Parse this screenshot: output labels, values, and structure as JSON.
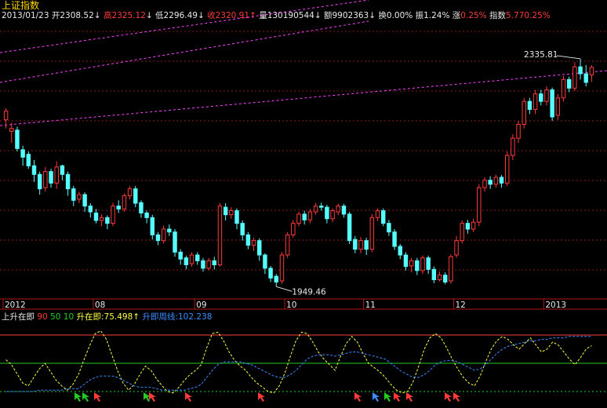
{
  "title": "上证指数",
  "quote": {
    "date": "2013/01/23",
    "open_label": "开",
    "open": "2308.52",
    "high_label": "高",
    "high": "2325.12",
    "low_label": "低",
    "low": "2296.49",
    "close_label": "收",
    "close": "2320.91",
    "vol_label": "量",
    "vol": "130190544",
    "amt_label": "额",
    "amt": "9902363",
    "turn_label": "换",
    "turn": "0.00%",
    "amp_label": "振",
    "amp": "1.24%",
    "chg_label": "涨",
    "chg": "0.25%",
    "idx_label": "指数",
    "idx": "5.77",
    "idx_chg": "0.25%"
  },
  "colors": {
    "up": "#ff3a3a",
    "down": "#55ffff",
    "bg": "#000000",
    "grid": "#8a1c1c",
    "axis": "#b01818",
    "title": "#ffd800",
    "trend": "#ff44ff"
  },
  "chart_data": [
    {
      "type": "candlestick",
      "title": "上证指数",
      "x_ticks": [
        "2012",
        "08",
        "09",
        "10",
        "11",
        "12",
        "2013"
      ],
      "annotations": [
        {
          "text": "2335.81",
          "kind": "high"
        },
        {
          "text": "1949.46",
          "kind": "low"
        }
      ],
      "ylim": [
        1920,
        2400
      ],
      "grid": true,
      "candles": [
        [
          2230,
          2245,
          2215,
          2250
        ],
        [
          2210,
          2215,
          2190,
          2225
        ],
        [
          2212,
          2180,
          2175,
          2218
        ],
        [
          2178,
          2165,
          2150,
          2185
        ],
        [
          2170,
          2150,
          2145,
          2175
        ],
        [
          2150,
          2135,
          2122,
          2160
        ],
        [
          2135,
          2110,
          2100,
          2140
        ],
        [
          2112,
          2140,
          2105,
          2148
        ],
        [
          2140,
          2120,
          2112,
          2145
        ],
        [
          2120,
          2148,
          2110,
          2158
        ],
        [
          2150,
          2135,
          2125,
          2152
        ],
        [
          2135,
          2110,
          2098,
          2140
        ],
        [
          2110,
          2090,
          2080,
          2115
        ],
        [
          2092,
          2100,
          2085,
          2105
        ],
        [
          2100,
          2080,
          2070,
          2104
        ],
        [
          2080,
          2070,
          2060,
          2085
        ],
        [
          2068,
          2055,
          2050,
          2075
        ],
        [
          2055,
          2060,
          2045,
          2066
        ],
        [
          2060,
          2050,
          2040,
          2064
        ],
        [
          2050,
          2080,
          2045,
          2086
        ],
        [
          2080,
          2075,
          2068,
          2090
        ],
        [
          2075,
          2098,
          2070,
          2102
        ],
        [
          2098,
          2110,
          2092,
          2115
        ],
        [
          2110,
          2085,
          2078,
          2115
        ],
        [
          2086,
          2068,
          2060,
          2090
        ],
        [
          2068,
          2060,
          2050,
          2072
        ],
        [
          2060,
          2030,
          2022,
          2065
        ],
        [
          2030,
          2020,
          2012,
          2035
        ],
        [
          2020,
          2040,
          2015,
          2046
        ],
        [
          2040,
          2035,
          2028,
          2048
        ],
        [
          2035,
          2000,
          1992,
          2040
        ],
        [
          2000,
          1988,
          1978,
          2005
        ],
        [
          1990,
          1978,
          1970,
          1994
        ],
        [
          1980,
          1995,
          1975,
          2000
        ],
        [
          1995,
          1985,
          1978,
          2000
        ],
        [
          1985,
          1972,
          1966,
          1990
        ],
        [
          1972,
          1985,
          1968,
          1990
        ],
        [
          1985,
          1978,
          1970,
          1992
        ],
        [
          1978,
          2080,
          1975,
          2085
        ],
        [
          2078,
          2065,
          2055,
          2085
        ],
        [
          2065,
          2072,
          2058,
          2078
        ],
        [
          2072,
          2050,
          2040,
          2076
        ],
        [
          2050,
          2030,
          2020,
          2055
        ],
        [
          2030,
          2012,
          2005,
          2035
        ],
        [
          2012,
          2020,
          2002,
          2025
        ],
        [
          2020,
          1995,
          1985,
          2024
        ],
        [
          1995,
          1972,
          1962,
          1998
        ],
        [
          1972,
          1955,
          1948,
          1976
        ],
        [
          1958,
          1948,
          1940,
          1962
        ],
        [
          1950,
          1995,
          1945,
          2000
        ],
        [
          1995,
          2030,
          1990,
          2035
        ],
        [
          2030,
          2050,
          2025,
          2056
        ],
        [
          2050,
          2066,
          2045,
          2070
        ],
        [
          2066,
          2056,
          2048,
          2072
        ],
        [
          2056,
          2070,
          2050,
          2075
        ],
        [
          2070,
          2080,
          2065,
          2085
        ],
        [
          2080,
          2078,
          2072,
          2086
        ],
        [
          2078,
          2058,
          2050,
          2082
        ],
        [
          2058,
          2072,
          2052,
          2076
        ],
        [
          2070,
          2080,
          2064,
          2084
        ],
        [
          2080,
          2066,
          2060,
          2084
        ],
        [
          2066,
          2020,
          2014,
          2070
        ],
        [
          2022,
          2005,
          1998,
          2028
        ],
        [
          2005,
          2020,
          1998,
          2026
        ],
        [
          2020,
          2005,
          1995,
          2025
        ],
        [
          2005,
          2060,
          2000,
          2066
        ],
        [
          2060,
          2072,
          2054,
          2076
        ],
        [
          2072,
          2050,
          2045,
          2076
        ],
        [
          2050,
          2035,
          2028,
          2056
        ],
        [
          2035,
          2010,
          2004,
          2040
        ],
        [
          2010,
          1995,
          1988,
          2014
        ],
        [
          1995,
          1975,
          1968,
          2000
        ],
        [
          1976,
          1985,
          1965,
          1990
        ],
        [
          1985,
          1968,
          1960,
          1990
        ],
        [
          1968,
          1990,
          1962,
          1994
        ],
        [
          1990,
          1970,
          1962,
          1994
        ],
        [
          1970,
          1952,
          1946,
          1975
        ],
        [
          1952,
          1960,
          1949,
          1966
        ],
        [
          1960,
          1948,
          1944,
          1965
        ],
        [
          1950,
          1992,
          1945,
          1996
        ],
        [
          1995,
          2020,
          1990,
          2028
        ],
        [
          2020,
          2050,
          2015,
          2055
        ],
        [
          2050,
          2040,
          2032,
          2056
        ],
        [
          2040,
          2052,
          2035,
          2058
        ],
        [
          2052,
          2112,
          2045,
          2118
        ],
        [
          2112,
          2125,
          2105,
          2130
        ],
        [
          2125,
          2118,
          2110,
          2132
        ],
        [
          2118,
          2130,
          2112,
          2135
        ],
        [
          2130,
          2120,
          2112,
          2134
        ],
        [
          2120,
          2168,
          2115,
          2175
        ],
        [
          2168,
          2198,
          2160,
          2205
        ],
        [
          2198,
          2222,
          2190,
          2228
        ],
        [
          2222,
          2262,
          2215,
          2268
        ],
        [
          2262,
          2248,
          2240,
          2268
        ],
        [
          2248,
          2275,
          2240,
          2282
        ],
        [
          2275,
          2262,
          2255,
          2282
        ],
        [
          2262,
          2282,
          2255,
          2288
        ],
        [
          2282,
          2235,
          2228,
          2286
        ],
        [
          2238,
          2268,
          2230,
          2275
        ],
        [
          2268,
          2300,
          2262,
          2306
        ],
        [
          2300,
          2285,
          2278,
          2305
        ],
        [
          2285,
          2322,
          2280,
          2330
        ],
        [
          2322,
          2310,
          2300,
          2336
        ],
        [
          2310,
          2295,
          2288,
          2325
        ],
        [
          2308,
          2321,
          2296,
          2325
        ]
      ]
    },
    {
      "type": "line",
      "title": "上升在即",
      "levels": [
        "90",
        "50",
        "10"
      ],
      "series": [
        {
          "name": "升在即",
          "value": "75.498",
          "color": "#ffff40",
          "style": "dashed",
          "values": [
            55,
            48,
            35,
            22,
            18,
            30,
            42,
            50,
            38,
            26,
            18,
            12,
            20,
            34,
            55,
            75,
            92,
            96,
            84,
            62,
            40,
            22,
            12,
            20,
            34,
            46,
            40,
            28,
            18,
            10,
            8,
            16,
            26,
            34,
            40,
            48,
            72,
            92,
            94,
            82,
            66,
            54,
            46,
            40,
            30,
            22,
            16,
            10,
            8,
            18,
            36,
            60,
            82,
            94,
            92,
            80,
            66,
            56,
            48,
            40,
            60,
            78,
            88,
            80,
            64,
            50,
            44,
            38,
            30,
            20,
            12,
            8,
            10,
            24,
            46,
            70,
            86,
            92,
            86,
            72,
            56,
            42,
            30,
            22,
            18,
            32,
            52,
            70,
            82,
            88,
            84,
            76,
            70,
            78,
            86,
            76,
            66,
            70,
            80,
            76,
            66,
            56,
            48,
            58,
            70,
            75
          ]
        },
        {
          "name": "升即周线",
          "value": "102.238",
          "color": "#3a8cff",
          "style": "dashed",
          "values": [
            10,
            10,
            10,
            10,
            10,
            10,
            12,
            12,
            12,
            12,
            12,
            14,
            14,
            14,
            20,
            26,
            30,
            32,
            32,
            32,
            30,
            26,
            22,
            18,
            16,
            16,
            16,
            14,
            12,
            12,
            12,
            12,
            12,
            14,
            16,
            20,
            30,
            40,
            48,
            52,
            52,
            52,
            52,
            50,
            48,
            44,
            40,
            36,
            32,
            30,
            30,
            34,
            40,
            48,
            56,
            60,
            62,
            62,
            62,
            60,
            62,
            64,
            66,
            66,
            64,
            62,
            60,
            58,
            56,
            50,
            44,
            38,
            34,
            30,
            30,
            34,
            40,
            48,
            52,
            54,
            54,
            52,
            48,
            44,
            40,
            42,
            48,
            56,
            64,
            70,
            74,
            76,
            78,
            80,
            82,
            82,
            84,
            84,
            86,
            86,
            86,
            88,
            88,
            88,
            88,
            88
          ]
        }
      ],
      "ylim": [
        0,
        100
      ]
    }
  ]
}
